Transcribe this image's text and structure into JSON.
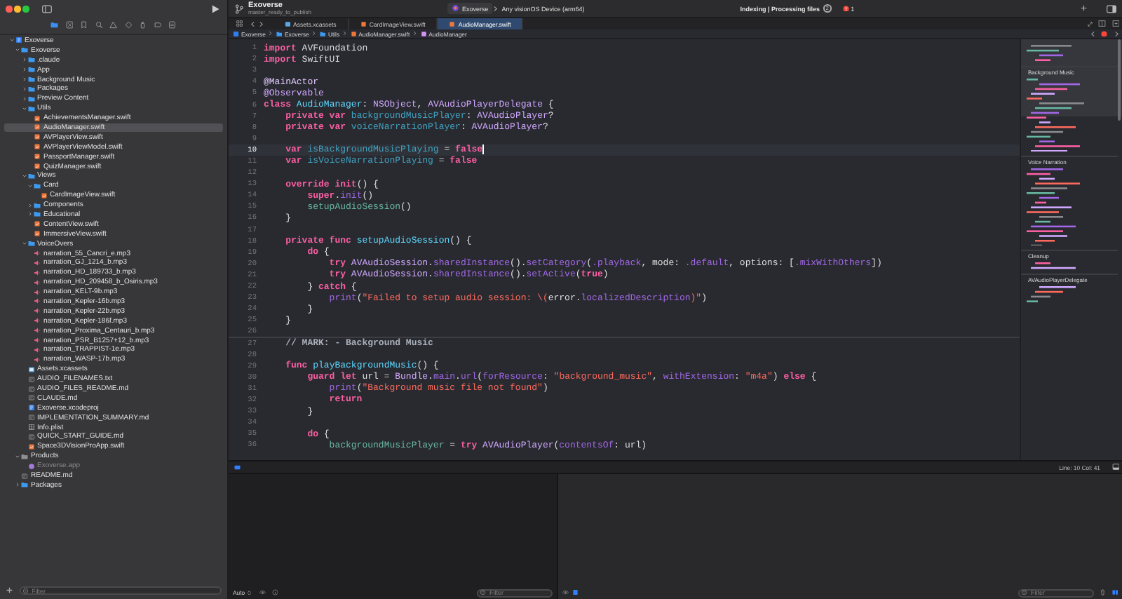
{
  "window": {
    "title": "Exoverse",
    "branch": "master_ready_to_publish"
  },
  "scheme": {
    "project": "Exoverse",
    "destination": "Any visionOS Device (arm64)"
  },
  "activity": {
    "status": "Indexing | Processing files",
    "count": "2"
  },
  "issues": {
    "errors": "1"
  },
  "navigator": {
    "tree": [
      {
        "label": "Exoverse",
        "kind": "project",
        "expanded": true,
        "selected": false,
        "children": [
          {
            "label": "Exoverse",
            "kind": "folder",
            "expanded": true,
            "selected": false,
            "children": [
              {
                "label": ".claude",
                "kind": "folder",
                "expanded": false,
                "selected": false
              },
              {
                "label": "App",
                "kind": "folder",
                "expanded": false,
                "selected": false
              },
              {
                "label": "Background Music",
                "kind": "folder",
                "expanded": false,
                "selected": false
              },
              {
                "label": "Packages",
                "kind": "folder",
                "expanded": false,
                "selected": false
              },
              {
                "label": "Preview Content",
                "kind": "folder",
                "expanded": false,
                "selected": false
              },
              {
                "label": "Utils",
                "kind": "folder",
                "expanded": true,
                "selected": false,
                "children": [
                  {
                    "label": "AchievementsManager.swift",
                    "kind": "swift",
                    "selected": false
                  },
                  {
                    "label": "AudioManager.swift",
                    "kind": "swift",
                    "selected": true
                  },
                  {
                    "label": "AVPlayerView.swift",
                    "kind": "swift",
                    "selected": false
                  },
                  {
                    "label": "AVPlayerViewModel.swift",
                    "kind": "swift",
                    "selected": false
                  },
                  {
                    "label": "PassportManager.swift",
                    "kind": "swift",
                    "selected": false
                  },
                  {
                    "label": "QuizManager.swift",
                    "kind": "swift",
                    "selected": false
                  }
                ]
              },
              {
                "label": "Views",
                "kind": "folder",
                "expanded": true,
                "selected": false,
                "children": [
                  {
                    "label": "Card",
                    "kind": "folder",
                    "expanded": true,
                    "selected": false,
                    "children": [
                      {
                        "label": "CardImageView.swift",
                        "kind": "swift",
                        "selected": false
                      }
                    ]
                  },
                  {
                    "label": "Components",
                    "kind": "folder",
                    "expanded": false,
                    "selected": false
                  },
                  {
                    "label": "Educational",
                    "kind": "folder",
                    "expanded": false,
                    "selected": false
                  },
                  {
                    "label": "ContentView.swift",
                    "kind": "swift",
                    "selected": false
                  },
                  {
                    "label": "ImmersiveView.swift",
                    "kind": "swift",
                    "selected": false
                  }
                ]
              },
              {
                "label": "VoiceOvers",
                "kind": "folder",
                "expanded": true,
                "selected": false,
                "children": [
                  {
                    "label": "narration_55_Cancri_e.mp3",
                    "kind": "audio",
                    "selected": false
                  },
                  {
                    "label": "narration_GJ_1214_b.mp3",
                    "kind": "audio",
                    "selected": false
                  },
                  {
                    "label": "narration_HD_189733_b.mp3",
                    "kind": "audio",
                    "selected": false
                  },
                  {
                    "label": "narration_HD_209458_b_Osiris.mp3",
                    "kind": "audio",
                    "selected": false
                  },
                  {
                    "label": "narration_KELT-9b.mp3",
                    "kind": "audio",
                    "selected": false
                  },
                  {
                    "label": "narration_Kepler-16b.mp3",
                    "kind": "audio",
                    "selected": false
                  },
                  {
                    "label": "narration_Kepler-22b.mp3",
                    "kind": "audio",
                    "selected": false
                  },
                  {
                    "label": "narration_Kepler-186f.mp3",
                    "kind": "audio",
                    "selected": false
                  },
                  {
                    "label": "narration_Proxima_Centauri_b.mp3",
                    "kind": "audio",
                    "selected": false
                  },
                  {
                    "label": "narration_PSR_B1257+12_b.mp3",
                    "kind": "audio",
                    "selected": false
                  },
                  {
                    "label": "narration_TRAPPIST-1e.mp3",
                    "kind": "audio",
                    "selected": false
                  },
                  {
                    "label": "narration_WASP-17b.mp3",
                    "kind": "audio",
                    "selected": false
                  }
                ]
              },
              {
                "label": "Assets.xcassets",
                "kind": "assets",
                "selected": false
              },
              {
                "label": "AUDIO_FILENAMES.txt",
                "kind": "text",
                "selected": false
              },
              {
                "label": "AUDIO_FILES_README.md",
                "kind": "text",
                "selected": false
              },
              {
                "label": "CLAUDE.md",
                "kind": "text",
                "selected": false
              },
              {
                "label": "Exoverse.xcodeproj",
                "kind": "project",
                "selected": false
              },
              {
                "label": "IMPLEMENTATION_SUMMARY.md",
                "kind": "text",
                "selected": false
              },
              {
                "label": "Info.plist",
                "kind": "plist",
                "selected": false
              },
              {
                "label": "QUICK_START_GUIDE.md",
                "kind": "text",
                "selected": false
              },
              {
                "label": "Space3DVisionProApp.swift",
                "kind": "swift",
                "selected": false
              }
            ]
          },
          {
            "label": "Products",
            "kind": "group",
            "expanded": true,
            "selected": false,
            "children": [
              {
                "label": "Exoverse.app",
                "kind": "app",
                "selected": false,
                "missing": true
              }
            ]
          },
          {
            "label": "README.md",
            "kind": "text",
            "selected": false
          },
          {
            "label": "Packages",
            "kind": "folder",
            "expanded": false,
            "selected": false
          }
        ]
      }
    ],
    "filter": {
      "placeholder": "Filter"
    }
  },
  "tabs": [
    {
      "label": "Assets.xcassets",
      "kind": "assets",
      "selected": false
    },
    {
      "label": "CardImageView.swift",
      "kind": "swift",
      "selected": false
    },
    {
      "label": "AudioManager.swift",
      "kind": "swift",
      "selected": true
    }
  ],
  "jump_bar": [
    {
      "label": "Exoverse",
      "kind": "project"
    },
    {
      "label": "Exoverse",
      "kind": "folder"
    },
    {
      "label": "Utils",
      "kind": "folder"
    },
    {
      "label": "AudioManager.swift",
      "kind": "swift"
    },
    {
      "label": "AudioManager",
      "kind": "class"
    }
  ],
  "editor": {
    "lines": [
      {
        "n": "1",
        "current": false,
        "tokens": [
          {
            "text": "import",
            "kind": "kw"
          },
          {
            "text": " AVFoundation",
            "kind": "plain"
          }
        ]
      },
      {
        "n": "2",
        "current": false,
        "tokens": [
          {
            "text": "import",
            "kind": "kw"
          },
          {
            "text": " SwiftUI",
            "kind": "plain"
          }
        ]
      },
      {
        "n": "3",
        "current": false
      },
      {
        "n": "4",
        "current": false,
        "tokens": [
          {
            "text": "@MainActor",
            "kind": "attr"
          }
        ]
      },
      {
        "n": "5",
        "current": false,
        "tokens": [
          {
            "text": "@Observable",
            "kind": "type"
          }
        ]
      },
      {
        "n": "6",
        "current": false,
        "tokens": [
          {
            "text": "class",
            "kind": "kw"
          },
          {
            "text": " AudioManager",
            "kind": "decl"
          },
          {
            "text": ": ",
            "kind": "plain"
          },
          {
            "text": "NSObject",
            "kind": "type"
          },
          {
            "text": ", ",
            "kind": "plain"
          },
          {
            "text": "AVAudioPlayerDelegate",
            "kind": "type"
          },
          {
            "text": " {",
            "kind": "plain"
          }
        ]
      },
      {
        "n": "7",
        "current": false,
        "tokens": [
          {
            "text": "    private var",
            "kind": "kw"
          },
          {
            "text": " backgroundMusicPlayer",
            "kind": "var"
          },
          {
            "text": ": ",
            "kind": "plain"
          },
          {
            "text": "AVAudioPlayer",
            "kind": "type"
          },
          {
            "text": "?",
            "kind": "plain"
          }
        ]
      },
      {
        "n": "8",
        "current": false,
        "tokens": [
          {
            "text": "    private var",
            "kind": "kw"
          },
          {
            "text": " voiceNarrationPlayer",
            "kind": "var"
          },
          {
            "text": ": ",
            "kind": "plain"
          },
          {
            "text": "AVAudioPlayer",
            "kind": "type"
          },
          {
            "text": "?",
            "kind": "plain"
          }
        ]
      },
      {
        "n": "9",
        "current": false
      },
      {
        "n": "10",
        "current": true,
        "tokens": [
          {
            "text": "    var",
            "kind": "kw"
          },
          {
            "text": " isBackgroundMusicPlaying",
            "kind": "var"
          },
          {
            "text": " = ",
            "kind": "plain"
          },
          {
            "text": "false",
            "kind": "kw"
          }
        ]
      },
      {
        "n": "11",
        "current": false,
        "tokens": [
          {
            "text": "    var",
            "kind": "kw"
          },
          {
            "text": " isVoiceNarrationPlaying",
            "kind": "var"
          },
          {
            "text": " = ",
            "kind": "plain"
          },
          {
            "text": "false",
            "kind": "kw"
          }
        ]
      },
      {
        "n": "12",
        "current": false
      },
      {
        "n": "13",
        "current": false,
        "tokens": [
          {
            "text": "    override init",
            "kind": "kw"
          },
          {
            "text": "() {",
            "kind": "plain"
          }
        ]
      },
      {
        "n": "14",
        "current": false,
        "tokens": [
          {
            "text": "        super",
            "kind": "kw"
          },
          {
            "text": ".",
            "kind": "plain"
          },
          {
            "text": "init",
            "kind": "sys"
          },
          {
            "text": "()",
            "kind": "plain"
          }
        ]
      },
      {
        "n": "15",
        "current": false,
        "tokens": [
          {
            "text": "        setupAudioSession",
            "kind": "proj"
          },
          {
            "text": "()",
            "kind": "plain"
          }
        ]
      },
      {
        "n": "16",
        "current": false,
        "tokens": [
          {
            "text": "    }",
            "kind": "plain"
          }
        ]
      },
      {
        "n": "17",
        "current": false
      },
      {
        "n": "18",
        "current": false,
        "tokens": [
          {
            "text": "    private func",
            "kind": "kw"
          },
          {
            "text": " setupAudioSession",
            "kind": "decl"
          },
          {
            "text": "() {",
            "kind": "plain"
          }
        ]
      },
      {
        "n": "19",
        "current": false,
        "tokens": [
          {
            "text": "        do",
            "kind": "kw"
          },
          {
            "text": " {",
            "kind": "plain"
          }
        ]
      },
      {
        "n": "20",
        "current": false,
        "tokens": [
          {
            "text": "            try",
            "kind": "kw"
          },
          {
            "text": " AVAudioSession",
            "kind": "type"
          },
          {
            "text": ".",
            "kind": "plain"
          },
          {
            "text": "sharedInstance",
            "kind": "sys"
          },
          {
            "text": "().",
            "kind": "plain"
          },
          {
            "text": "setCategory",
            "kind": "sys"
          },
          {
            "text": "(",
            "kind": "plain"
          },
          {
            "text": ".playback",
            "kind": "sys"
          },
          {
            "text": ", mode: ",
            "kind": "plain"
          },
          {
            "text": ".default",
            "kind": "sys"
          },
          {
            "text": ", options: [",
            "kind": "plain"
          },
          {
            "text": ".mixWithOthers",
            "kind": "sys"
          },
          {
            "text": "])",
            "kind": "plain"
          }
        ]
      },
      {
        "n": "21",
        "current": false,
        "tokens": [
          {
            "text": "            try",
            "kind": "kw"
          },
          {
            "text": " AVAudioSession",
            "kind": "type"
          },
          {
            "text": ".",
            "kind": "plain"
          },
          {
            "text": "sharedInstance",
            "kind": "sys"
          },
          {
            "text": "().",
            "kind": "plain"
          },
          {
            "text": "setActive",
            "kind": "sys"
          },
          {
            "text": "(",
            "kind": "plain"
          },
          {
            "text": "true",
            "kind": "kw"
          },
          {
            "text": ")",
            "kind": "plain"
          }
        ]
      },
      {
        "n": "22",
        "current": false,
        "tokens": [
          {
            "text": "        } ",
            "kind": "plain"
          },
          {
            "text": "catch",
            "kind": "kw"
          },
          {
            "text": " {",
            "kind": "plain"
          }
        ]
      },
      {
        "n": "23",
        "current": false,
        "tokens": [
          {
            "text": "            print",
            "kind": "sys"
          },
          {
            "text": "(",
            "kind": "plain"
          },
          {
            "text": "\"Failed to setup audio session: \\(",
            "kind": "str"
          },
          {
            "text": "error.",
            "kind": "plain"
          },
          {
            "text": "localizedDescription",
            "kind": "sys"
          },
          {
            "text": ")\"",
            "kind": "str"
          },
          {
            "text": ")",
            "kind": "plain"
          }
        ]
      },
      {
        "n": "24",
        "current": false,
        "tokens": [
          {
            "text": "        }",
            "kind": "plain"
          }
        ]
      },
      {
        "n": "25",
        "current": false,
        "tokens": [
          {
            "text": "    }",
            "kind": "plain"
          }
        ]
      },
      {
        "n": "26",
        "current": false
      },
      {
        "n": "27",
        "current": false,
        "tokens": [
          {
            "text": "    // MARK: - Background Music",
            "kind": "mark"
          }
        ]
      },
      {
        "n": "28",
        "current": false
      },
      {
        "n": "29",
        "current": false,
        "tokens": [
          {
            "text": "    func",
            "kind": "kw"
          },
          {
            "text": " playBackgroundMusic",
            "kind": "decl"
          },
          {
            "text": "() {",
            "kind": "plain"
          }
        ]
      },
      {
        "n": "30",
        "current": false,
        "tokens": [
          {
            "text": "        guard let",
            "kind": "kw"
          },
          {
            "text": " url = ",
            "kind": "plain"
          },
          {
            "text": "Bundle",
            "kind": "type"
          },
          {
            "text": ".",
            "kind": "plain"
          },
          {
            "text": "main",
            "kind": "sys"
          },
          {
            "text": ".",
            "kind": "plain"
          },
          {
            "text": "url",
            "kind": "sys"
          },
          {
            "text": "(",
            "kind": "plain"
          },
          {
            "text": "forResource",
            "kind": "sys"
          },
          {
            "text": ": ",
            "kind": "plain"
          },
          {
            "text": "\"background_music\"",
            "kind": "str"
          },
          {
            "text": ", ",
            "kind": "plain"
          },
          {
            "text": "withExtension",
            "kind": "sys"
          },
          {
            "text": ": ",
            "kind": "plain"
          },
          {
            "text": "\"m4a\"",
            "kind": "str"
          },
          {
            "text": ") ",
            "kind": "plain"
          },
          {
            "text": "else",
            "kind": "kw"
          },
          {
            "text": " {",
            "kind": "plain"
          }
        ]
      },
      {
        "n": "31",
        "current": false,
        "tokens": [
          {
            "text": "            print",
            "kind": "sys"
          },
          {
            "text": "(",
            "kind": "plain"
          },
          {
            "text": "\"Background music file not found\"",
            "kind": "str"
          },
          {
            "text": ")",
            "kind": "plain"
          }
        ]
      },
      {
        "n": "32",
        "current": false,
        "tokens": [
          {
            "text": "            return",
            "kind": "kw"
          }
        ]
      },
      {
        "n": "33",
        "current": false,
        "tokens": [
          {
            "text": "        }",
            "kind": "plain"
          }
        ]
      },
      {
        "n": "34",
        "current": false
      },
      {
        "n": "35",
        "current": false,
        "tokens": [
          {
            "text": "        do",
            "kind": "kw"
          },
          {
            "text": " {",
            "kind": "plain"
          }
        ]
      },
      {
        "n": "36",
        "current": false,
        "tokens": [
          {
            "text": "            backgroundMusicPlayer",
            "kind": "proj"
          },
          {
            "text": " = ",
            "kind": "plain"
          },
          {
            "text": "try",
            "kind": "kw"
          },
          {
            "text": " AVAudioPlayer",
            "kind": "type"
          },
          {
            "text": "(",
            "kind": "plain"
          },
          {
            "text": "contentsOf",
            "kind": "sys"
          },
          {
            "text": ": url)",
            "kind": "plain"
          }
        ]
      }
    ]
  },
  "minimap": {
    "sections": [
      "Background Music",
      "Voice Narration",
      "Cleanup",
      "AVAudioPlayerDelegate"
    ]
  },
  "cursor_position": "Line: 10  Col: 41",
  "debug": {
    "scope": "Auto",
    "console_filter": {
      "placeholder": "Filter"
    },
    "variables_filter": {
      "placeholder": "Filter"
    }
  }
}
